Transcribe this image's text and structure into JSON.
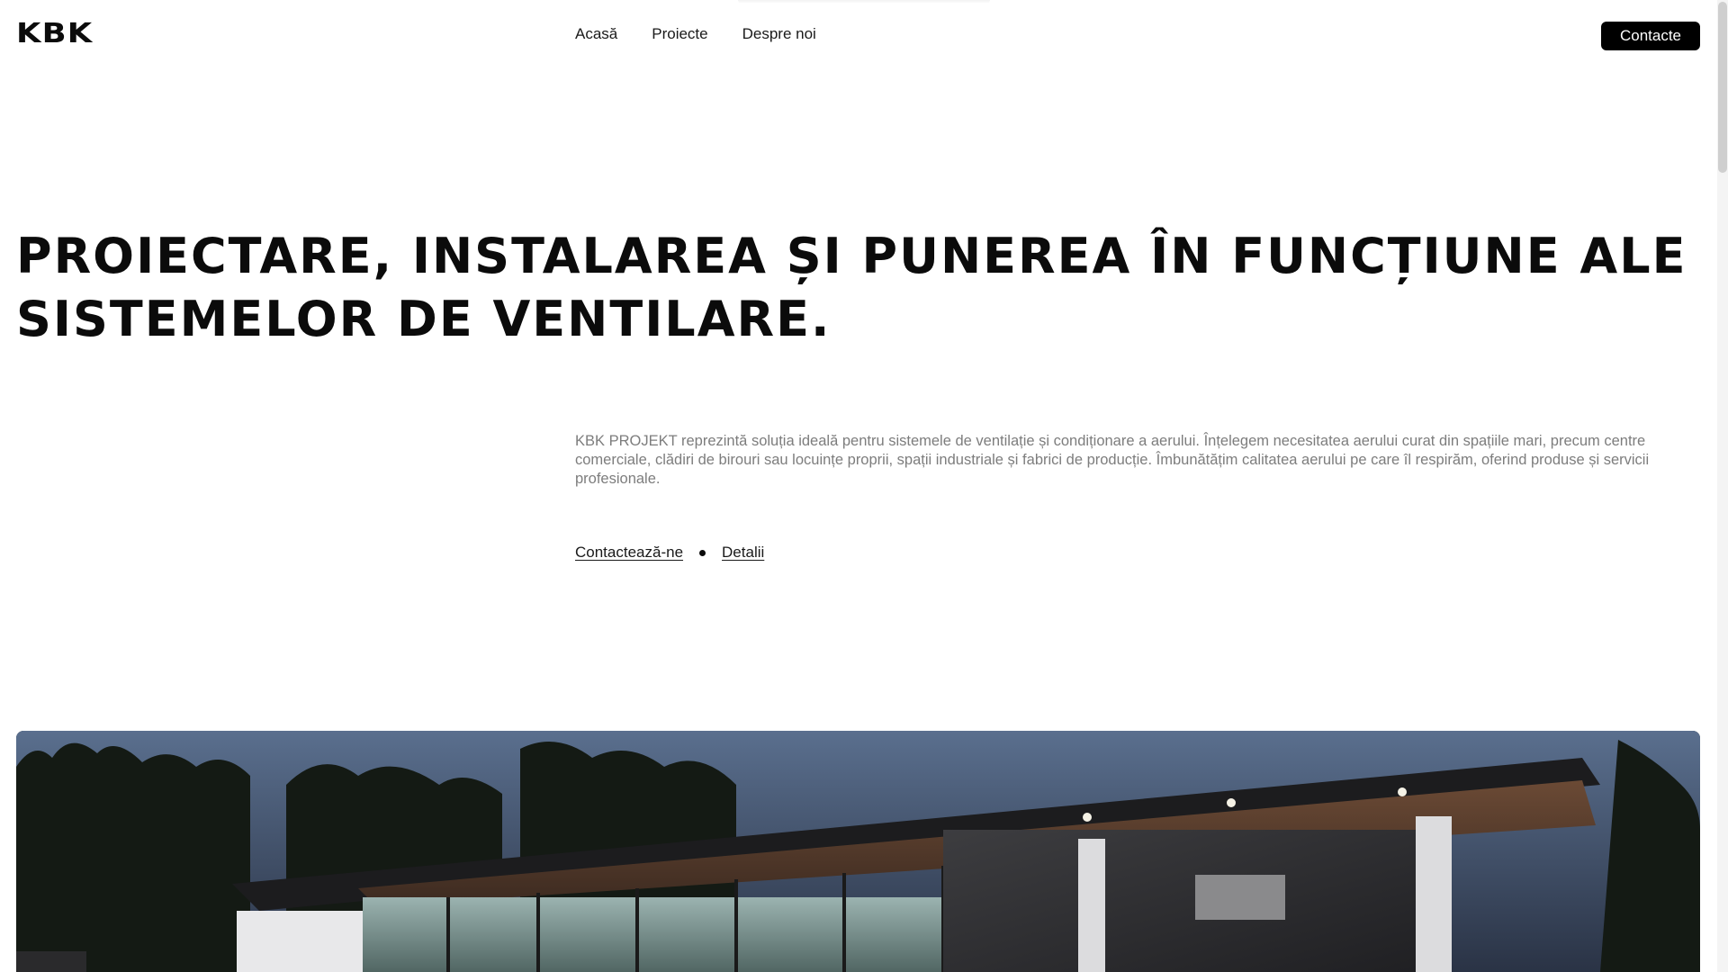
{
  "header": {
    "logo": "KBK",
    "nav": [
      {
        "label": "Acasă"
      },
      {
        "label": "Proiecte"
      },
      {
        "label": "Despre noi"
      }
    ],
    "contact_button": "Contacte"
  },
  "hero": {
    "title_line1": "PROIECTARE, INSTALAREA ȘI PUNEREA ÎN FUNCȚIUNE ALE",
    "title_line2": "SISTEMELOR DE VENTILARE.",
    "description": "KBK PROJEKT reprezintă soluția ideală pentru sistemele de ventilație și condiționare a aerului. Înțelegem necesitatea aerului curat din spațiile mari, precum centre comerciale, clădiri de birouri sau locuințe proprii, spații industriale și fabrici de producție. Îmbunătățim calitatea aerului pe care îl respirăm, oferind produse și servicii profesionale.",
    "link_contact": "Contactează-ne",
    "link_details": "Detalii"
  },
  "colors": {
    "accent": "#000000",
    "text": "#0b0b0b",
    "muted": "#7d7d7d",
    "background": "#ffffff"
  }
}
